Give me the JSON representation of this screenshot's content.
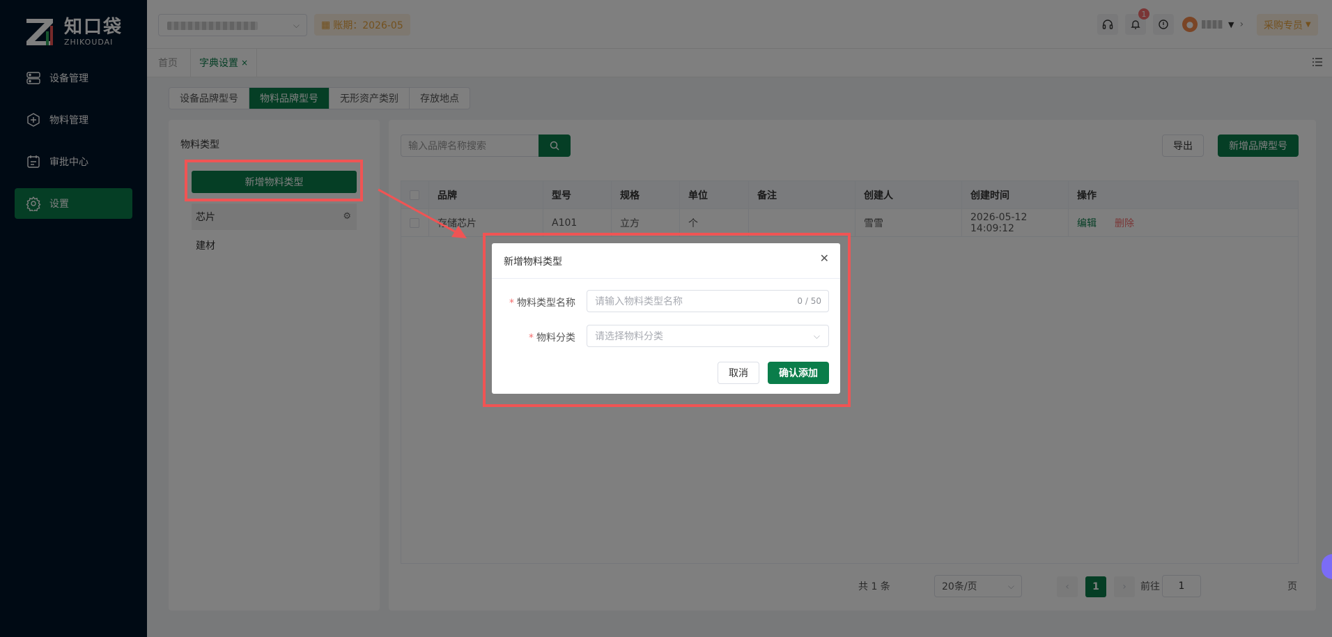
{
  "brand": {
    "name_cn": "知口袋",
    "name_en": "ZHIKOUDAI"
  },
  "sidebar": {
    "items": [
      {
        "label": "设备管理",
        "icon": "device-icon"
      },
      {
        "label": "物料管理",
        "icon": "material-icon"
      },
      {
        "label": "审批中心",
        "icon": "approval-icon"
      },
      {
        "label": "设置",
        "icon": "settings-icon",
        "active": true
      }
    ]
  },
  "topbar": {
    "period_label": "账期：2026-05",
    "notification_count": "1",
    "role_label": "采购专员"
  },
  "tabs": {
    "home": "首页",
    "dict": "字典设置",
    "close": "×"
  },
  "segments": [
    "设备品牌型号",
    "物料品牌型号",
    "无形资产类别",
    "存放地点"
  ],
  "left": {
    "title": "物料类型",
    "add_button": "新增物料类型",
    "types": [
      "芯片",
      "建材"
    ]
  },
  "main": {
    "search_placeholder": "输入品牌名称搜索",
    "export_button": "导出",
    "add_brand_button": "新增品牌型号",
    "columns": [
      "品牌",
      "型号",
      "规格",
      "单位",
      "备注",
      "创建人",
      "创建时间",
      "操作"
    ],
    "rows": [
      {
        "brand": "存储芯片",
        "model": "A101",
        "spec": "立方",
        "unit": "个",
        "remark": "",
        "creator": "雪雪",
        "created": "2026-05-12 14:09:12",
        "edit": "编辑",
        "delete": "删除"
      }
    ]
  },
  "pagination": {
    "total": "共 1 条",
    "page_size": "20条/页",
    "current": "1",
    "goto_label": "前往",
    "goto_value": "1",
    "page_unit": "页"
  },
  "dialog": {
    "title": "新增物料类型",
    "name_label": "物料类型名称",
    "name_placeholder": "请输入物料类型名称",
    "name_counter": "0 / 50",
    "category_label": "物料分类",
    "category_placeholder": "请选择物料分类",
    "cancel": "取消",
    "confirm": "确认添加"
  },
  "colors": {
    "primary": "#0a7d4a",
    "sidebar": "#001529",
    "highlight": "#f05454",
    "warning": "#e6a23c",
    "danger": "#f56c6c"
  }
}
